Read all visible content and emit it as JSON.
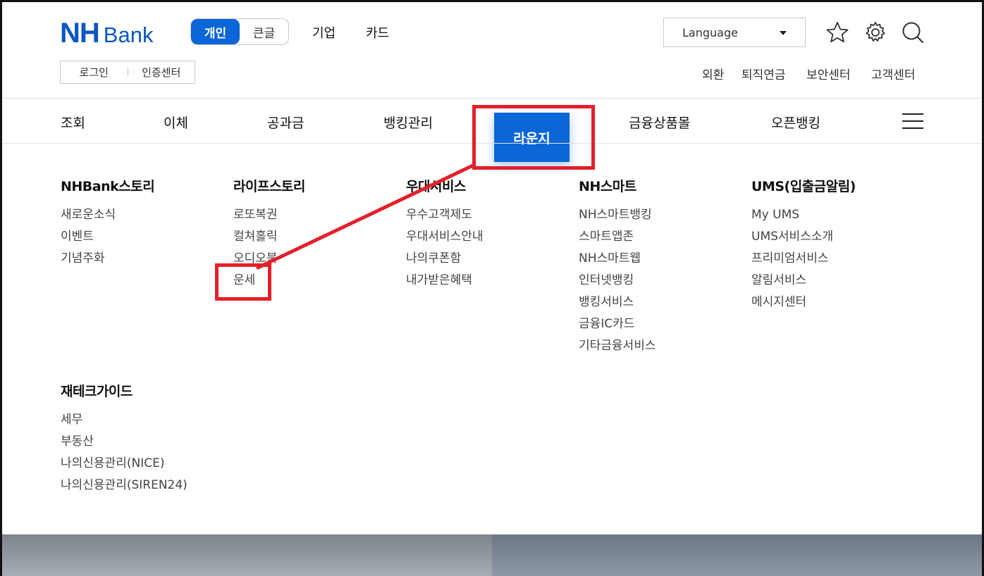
{
  "header": {
    "logo": {
      "nh": "NH",
      "bank": "Bank"
    },
    "segment": {
      "personal": "개인",
      "large_text": "큰글"
    },
    "top_links": [
      "기업",
      "카드"
    ],
    "language": {
      "label": "Language"
    },
    "auth": {
      "login": "로그인",
      "cert": "인증센터"
    },
    "util_links": [
      "외환",
      "퇴직연금",
      "보안센터",
      "고객센터"
    ],
    "icons": [
      "star-icon",
      "gear-icon",
      "search-icon"
    ]
  },
  "nav": {
    "items": [
      "조회",
      "이체",
      "공과금",
      "뱅킹관리",
      "라운지",
      "금융상품몰",
      "오픈뱅킹"
    ],
    "active": "라운지"
  },
  "menu": {
    "columns": [
      {
        "title": "NHBank스토리",
        "items": [
          "새로운소식",
          "이벤트",
          "기념주화"
        ]
      },
      {
        "title": "라이프스토리",
        "items": [
          "로또복권",
          "컬쳐홀릭",
          "오디오북",
          "운세"
        ]
      },
      {
        "title": "우대서비스",
        "items": [
          "우수고객제도",
          "우대서비스안내",
          "나의쿠폰함",
          "내가받은혜택"
        ]
      },
      {
        "title": "NH스마트",
        "items": [
          "NH스마트뱅킹",
          "스마트앱존",
          "NH스마트웹",
          "인터넷뱅킹",
          "뱅킹서비스",
          "금융IC카드",
          "기타금융서비스"
        ]
      },
      {
        "title": "UMS(입출금알림)",
        "items": [
          "My UMS",
          "UMS서비스소개",
          "프리미엄서비스",
          "알림서비스",
          "메시지센터"
        ]
      },
      {
        "title": "재테크가이드",
        "items": [
          "세무",
          "부동산",
          "나의신용관리(NICE)",
          "나의신용관리(SIREN24)"
        ]
      }
    ]
  },
  "colors": {
    "brand": "#0a57c2",
    "accent": "#0b66d8",
    "annotation": "#e3202a"
  }
}
